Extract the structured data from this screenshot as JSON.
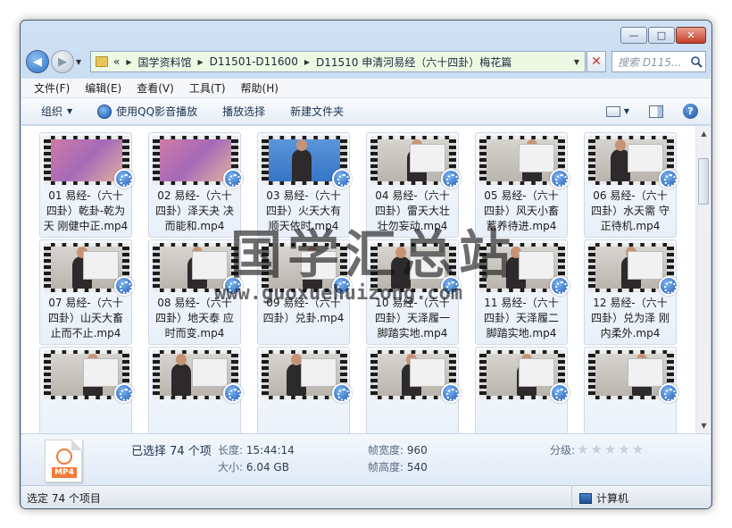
{
  "window": {
    "caption_buttons": [
      "—",
      "□",
      "✕"
    ]
  },
  "navigation": {
    "breadcrumb_prefix": "«",
    "breadcrumbs": [
      "国学资料馆",
      "D11501-D11600",
      "D11510 申清河易经（六十四卦）梅花篇"
    ],
    "search_placeholder": "搜索 D115..."
  },
  "menubar": [
    "文件(F)",
    "编辑(E)",
    "查看(V)",
    "工具(T)",
    "帮助(H)"
  ],
  "toolbar": {
    "organize": "组织",
    "qq_play": "使用QQ影音播放",
    "play_selection": "播放选择",
    "new_folder": "新建文件夹",
    "help": "?"
  },
  "files": [
    {
      "line1": "01 易经-（六十",
      "line2": "四卦）乾卦-乾为",
      "line3": "天 刚健中正.mp4",
      "thumb": "pink"
    },
    {
      "line1": "02 易经-（六十",
      "line2": "四卦）泽天夬 决",
      "line3": "而能和.mp4",
      "thumb": "pink"
    },
    {
      "line1": "03 易经-（六十",
      "line2": "四卦）火天大有",
      "line3": "顺天依时.mp4",
      "thumb": "blue"
    },
    {
      "line1": "04 易经-（六十",
      "line2": "四卦）雷天大壮",
      "line3": "壮勿妄动.mp4",
      "thumb": "room"
    },
    {
      "line1": "05 易经-（六十",
      "line2": "四卦）风天小畜",
      "line3": "蓄养待进.mp4",
      "thumb": "room"
    },
    {
      "line1": "06 易经-（六十",
      "line2": "四卦）水天需 守",
      "line3": "正待机.mp4",
      "thumb": "room"
    },
    {
      "line1": "07 易经-（六十",
      "line2": "四卦）山天大畜",
      "line3": "止而不止.mp4",
      "thumb": "room"
    },
    {
      "line1": "08 易经-（六十",
      "line2": "四卦）地天泰 应",
      "line3": "时而变.mp4",
      "thumb": "room"
    },
    {
      "line1": "09 易经-（六十",
      "line2": "四卦）兑卦.mp4",
      "line3": "",
      "thumb": "room"
    },
    {
      "line1": "10 易经-（六十",
      "line2": "四卦）天泽履一",
      "line3": "脚踏实地.mp4",
      "thumb": "room"
    },
    {
      "line1": "11 易经-（六十",
      "line2": "四卦）天泽履二",
      "line3": "脚踏实地.mp4",
      "thumb": "room"
    },
    {
      "line1": "12 易经-（六十",
      "line2": "四卦）兑为泽 刚",
      "line3": "内柔外.mp4",
      "thumb": "room"
    },
    {
      "line1": "",
      "line2": "",
      "line3": "",
      "thumb": "room"
    },
    {
      "line1": "",
      "line2": "",
      "line3": "",
      "thumb": "room"
    },
    {
      "line1": "",
      "line2": "",
      "line3": "",
      "thumb": "room"
    },
    {
      "line1": "",
      "line2": "",
      "line3": "",
      "thumb": "room"
    },
    {
      "line1": "",
      "line2": "",
      "line3": "",
      "thumb": "room"
    },
    {
      "line1": "",
      "line2": "",
      "line3": "",
      "thumb": "room"
    }
  ],
  "details": {
    "file_type_tag": "MP4",
    "selected": "已选择 74 个项",
    "length_label": "长度:",
    "length_value": "15:44:14",
    "size_label": "大小:",
    "size_value": "6.04 GB",
    "frame_width_label": "帧宽度:",
    "frame_width_value": "960",
    "frame_height_label": "帧高度:",
    "frame_height_value": "540",
    "rating_label": "分级:",
    "rating_stars": 0
  },
  "statusbar": {
    "left": "选定 74 个项目",
    "right": "计算机"
  },
  "watermark": {
    "cn": "国学汇总站",
    "url": "www.guoxuehuizong.com"
  },
  "colors": {
    "address_bg": "#eef9e4",
    "accent": "#1c55b0"
  }
}
